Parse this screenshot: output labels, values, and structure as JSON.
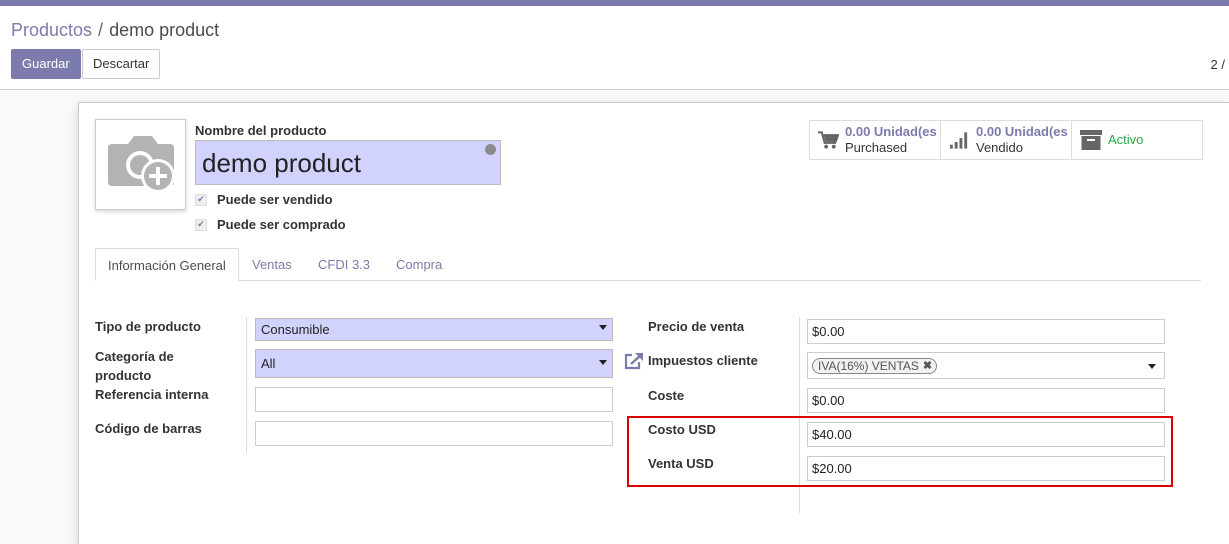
{
  "breadcrumb": {
    "parent": "Productos",
    "separator": "/",
    "current": "demo product"
  },
  "toolbar": {
    "save_label": "Guardar",
    "discard_label": "Descartar"
  },
  "pager": {
    "text": "2 /"
  },
  "product": {
    "name_label": "Nombre del producto",
    "name_value": "demo product",
    "can_be_sold_label": "Puede ser vendido",
    "can_be_sold": true,
    "can_be_purchased_label": "Puede ser comprado",
    "can_be_purchased": true
  },
  "stat_buttons": [
    {
      "icon": "shopping-cart-icon",
      "value": "0.00 Unidad(es",
      "label": "Purchased"
    },
    {
      "icon": "bar-chart-icon",
      "value": "0.00 Unidad(es",
      "label": "Vendido"
    },
    {
      "icon": "archive-icon",
      "value": "",
      "label": "Activo"
    }
  ],
  "tabs": [
    {
      "label": "Información General",
      "active": true
    },
    {
      "label": "Ventas",
      "active": false
    },
    {
      "label": "CFDI 3.3",
      "active": false
    },
    {
      "label": "Compra",
      "active": false
    }
  ],
  "left_fields": {
    "product_type_label": "Tipo de producto",
    "product_type_value": "Consumible",
    "category_label": "Categoría de producto",
    "category_value": "All",
    "internal_ref_label": "Referencia interna",
    "internal_ref_value": "",
    "barcode_label": "Código de barras",
    "barcode_value": ""
  },
  "right_fields": {
    "sale_price_label": "Precio de venta",
    "sale_price_value": "$0.00",
    "customer_taxes_label": "Impuestos cliente",
    "customer_tax_tag": "IVA(16%) VENTAS",
    "cost_label": "Coste",
    "cost_value": "$0.00",
    "cost_usd_label": "Costo USD",
    "cost_usd_value": "$40.00",
    "sale_usd_label": "Venta USD",
    "sale_usd_value": "$20.00"
  },
  "colors": {
    "brand": "#7c7bad",
    "required_field": "#d2d2ff",
    "active_status": "#28a745",
    "highlight": "#dd0000"
  }
}
